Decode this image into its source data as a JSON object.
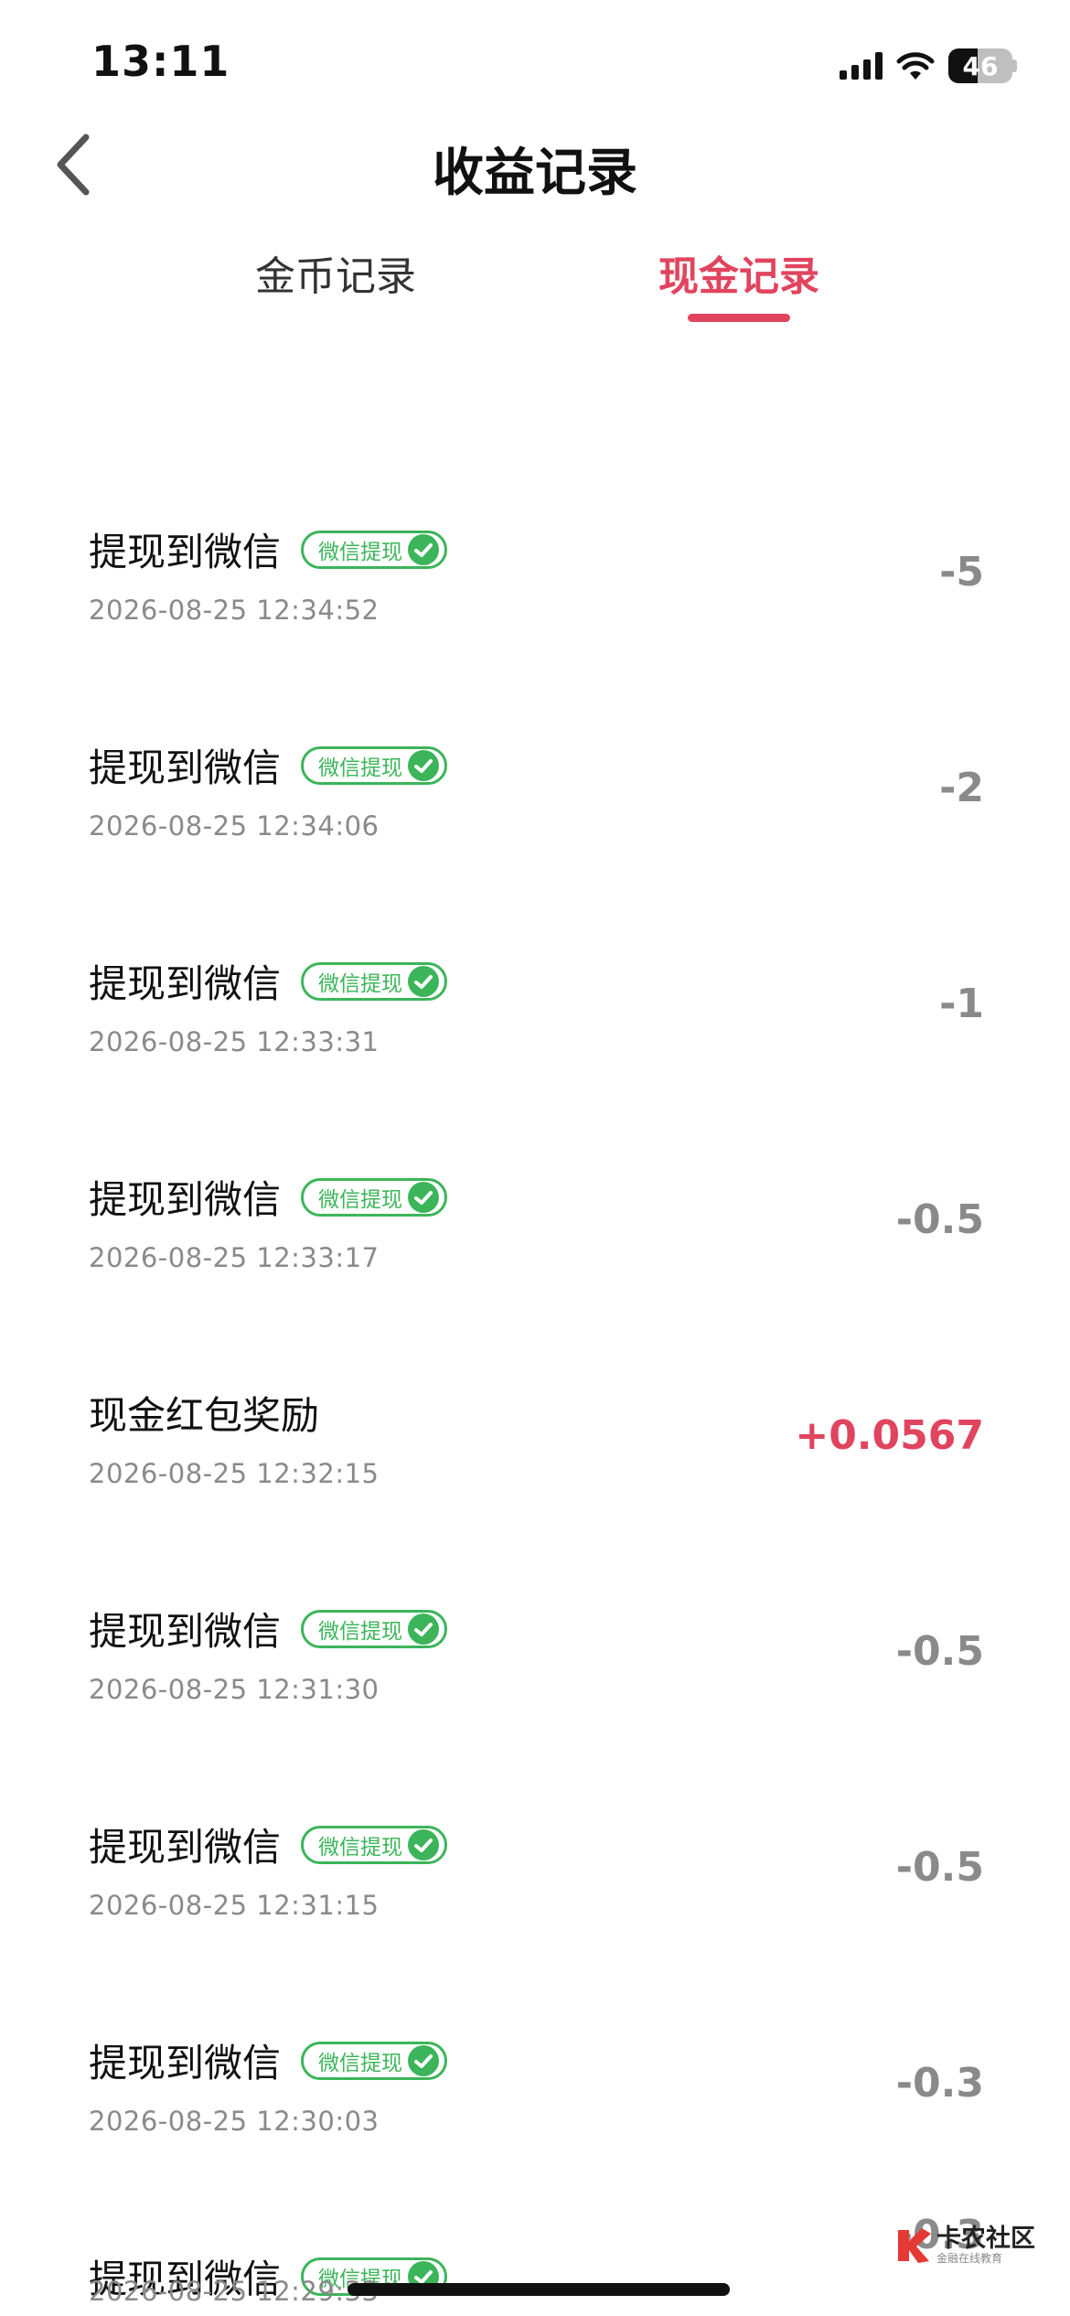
{
  "status": {
    "time": "13:11",
    "battery": "46"
  },
  "nav": {
    "title": "收益记录"
  },
  "tabs": {
    "coin": "金币记录",
    "cash": "现金记录"
  },
  "badge_label": "微信提现",
  "records": [
    {
      "title": "提现到微信",
      "time": "2026-08-25 12:34:52",
      "amount": "-5",
      "badge": true
    },
    {
      "title": "提现到微信",
      "time": "2026-08-25 12:34:06",
      "amount": "-2",
      "badge": true
    },
    {
      "title": "提现到微信",
      "time": "2026-08-25 12:33:31",
      "amount": "-1",
      "badge": true
    },
    {
      "title": "提现到微信",
      "time": "2026-08-25 12:33:17",
      "amount": "-0.5",
      "badge": true
    },
    {
      "title": "现金红包奖励",
      "time": "2026-08-25 12:32:15",
      "amount": "+0.0567",
      "badge": false
    },
    {
      "title": "提现到微信",
      "time": "2026-08-25 12:31:30",
      "amount": "-0.5",
      "badge": true
    },
    {
      "title": "提现到微信",
      "time": "2026-08-25 12:31:15",
      "amount": "-0.5",
      "badge": true
    },
    {
      "title": "提现到微信",
      "time": "2026-08-25 12:30:03",
      "amount": "-0.3",
      "badge": true
    },
    {
      "title": "提现到微信",
      "time": "2026-08-25 12:29:33",
      "amount": "-0.3",
      "badge": true
    }
  ],
  "colors": {
    "accent": "#e0445e",
    "wechat_green": "#3cb55a",
    "muted": "#8a8a8a"
  },
  "icons": {
    "back": "chevron-left-icon",
    "wechat": "wechat-icon",
    "wifi": "wifi-icon",
    "signal": "signal-icon"
  },
  "watermark": {
    "name": "卡农社区",
    "tagline": "金融在线教育"
  }
}
